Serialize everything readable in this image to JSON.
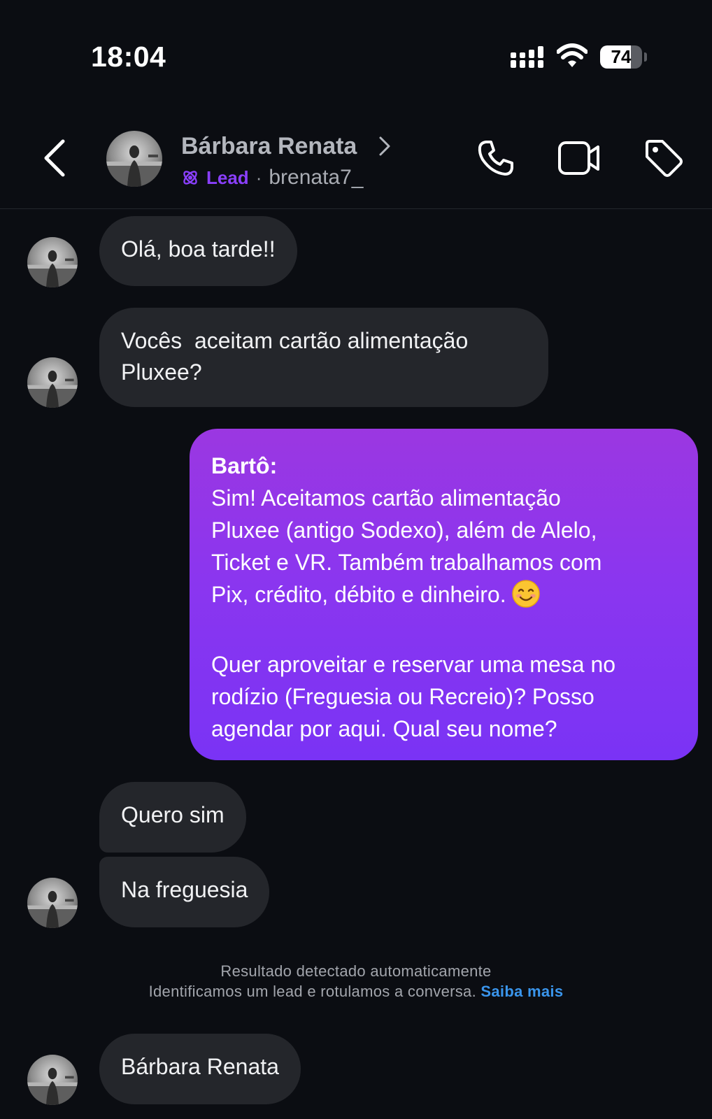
{
  "status_bar": {
    "time": "18:04",
    "battery_level": "74",
    "battery_fraction": 0.74,
    "icons": [
      "signal-icon",
      "wifi-icon",
      "battery-icon"
    ]
  },
  "header": {
    "contact_name": "Bárbara Renata",
    "lead_label": "Lead",
    "separator": "·",
    "username": "brenata7_",
    "icons": [
      "back-icon",
      "chevron-right-icon",
      "lead-icon",
      "call-icon",
      "video-call-icon",
      "tag-icon"
    ]
  },
  "messages": {
    "m1": "Olá, boa tarde!!",
    "m2_line1": "Vocês  aceitam cartão alimentação",
    "m2_line2": "Pluxee?",
    "reply": {
      "sender": "Bartô:",
      "p1_line1": "Sim! Aceitamos cartão alimentação",
      "p1_line2": "Pluxee (antigo Sodexo), além de Alelo,",
      "p1_line3": "Ticket e VR. Também trabalhamos com",
      "p1_line4": "Pix, crédito, débito e dinheiro.",
      "p2_line1": "Quer aproveitar e reservar uma mesa no",
      "p2_line2": "rodízio (Freguesia ou Recreio)? Posso",
      "p2_line3": "agendar por aqui. Qual seu nome?"
    },
    "m3": "Quero sim",
    "m4": "Na freguesia",
    "m5": "Bárbara Renata"
  },
  "system_notice": {
    "line1": "Resultado detectado automaticamente",
    "line2": "Identificamos um lead e rotulamos a conversa.",
    "link": "Saiba mais"
  },
  "colors": {
    "background": "#0b0d12",
    "incoming_bubble": "#24262b",
    "outgoing_gradient_top": "#9b37e1",
    "outgoing_gradient_bottom": "#7a33f5",
    "lead_accent": "#8a3ffc",
    "link": "#3a95ec"
  }
}
